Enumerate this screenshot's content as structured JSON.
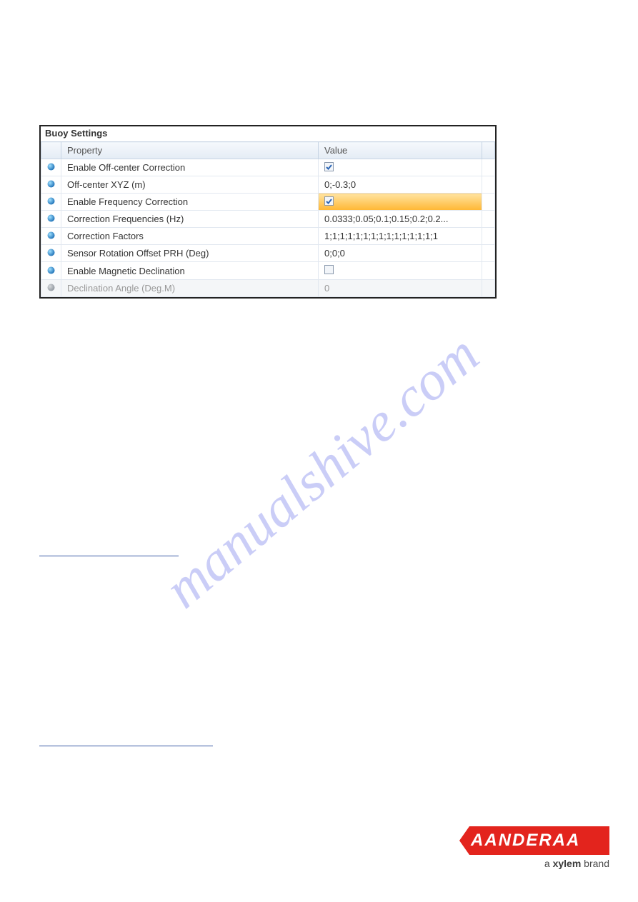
{
  "watermark_text": "manualshive.com",
  "panel": {
    "title": "Buoy Settings",
    "headers": {
      "property": "Property",
      "value": "Value"
    },
    "rows": [
      {
        "prop": "Enable Off-center Correction",
        "val_type": "checkbox",
        "checked": true,
        "enabled": true,
        "highlight": false
      },
      {
        "prop": "Off-center XYZ (m)",
        "val_type": "text",
        "val": "0;-0.3;0",
        "enabled": true,
        "highlight": false
      },
      {
        "prop": "Enable Frequency Correction",
        "val_type": "checkbox",
        "checked": true,
        "enabled": true,
        "highlight": true
      },
      {
        "prop": "Correction Frequencies (Hz)",
        "val_type": "text",
        "val": "0.0333;0.05;0.1;0.15;0.2;0.2...",
        "enabled": true,
        "highlight": false
      },
      {
        "prop": "Correction Factors",
        "val_type": "text",
        "val": "1;1;1;1;1;1;1;1;1;1;1;1;1;1;1",
        "enabled": true,
        "highlight": false
      },
      {
        "prop": "Sensor Rotation Offset PRH (Deg)",
        "val_type": "text",
        "val": "0;0;0",
        "enabled": true,
        "highlight": false
      },
      {
        "prop": "Enable Magnetic Declination",
        "val_type": "checkbox",
        "checked": false,
        "enabled": true,
        "highlight": false
      },
      {
        "prop": "Declination Angle (Deg.M)",
        "val_type": "text",
        "val": "0",
        "enabled": false,
        "highlight": false
      }
    ]
  },
  "logo": {
    "text": "AANDERAA",
    "tagline_prefix": "a ",
    "tagline_brand": "xylem",
    "tagline_suffix": " brand"
  }
}
